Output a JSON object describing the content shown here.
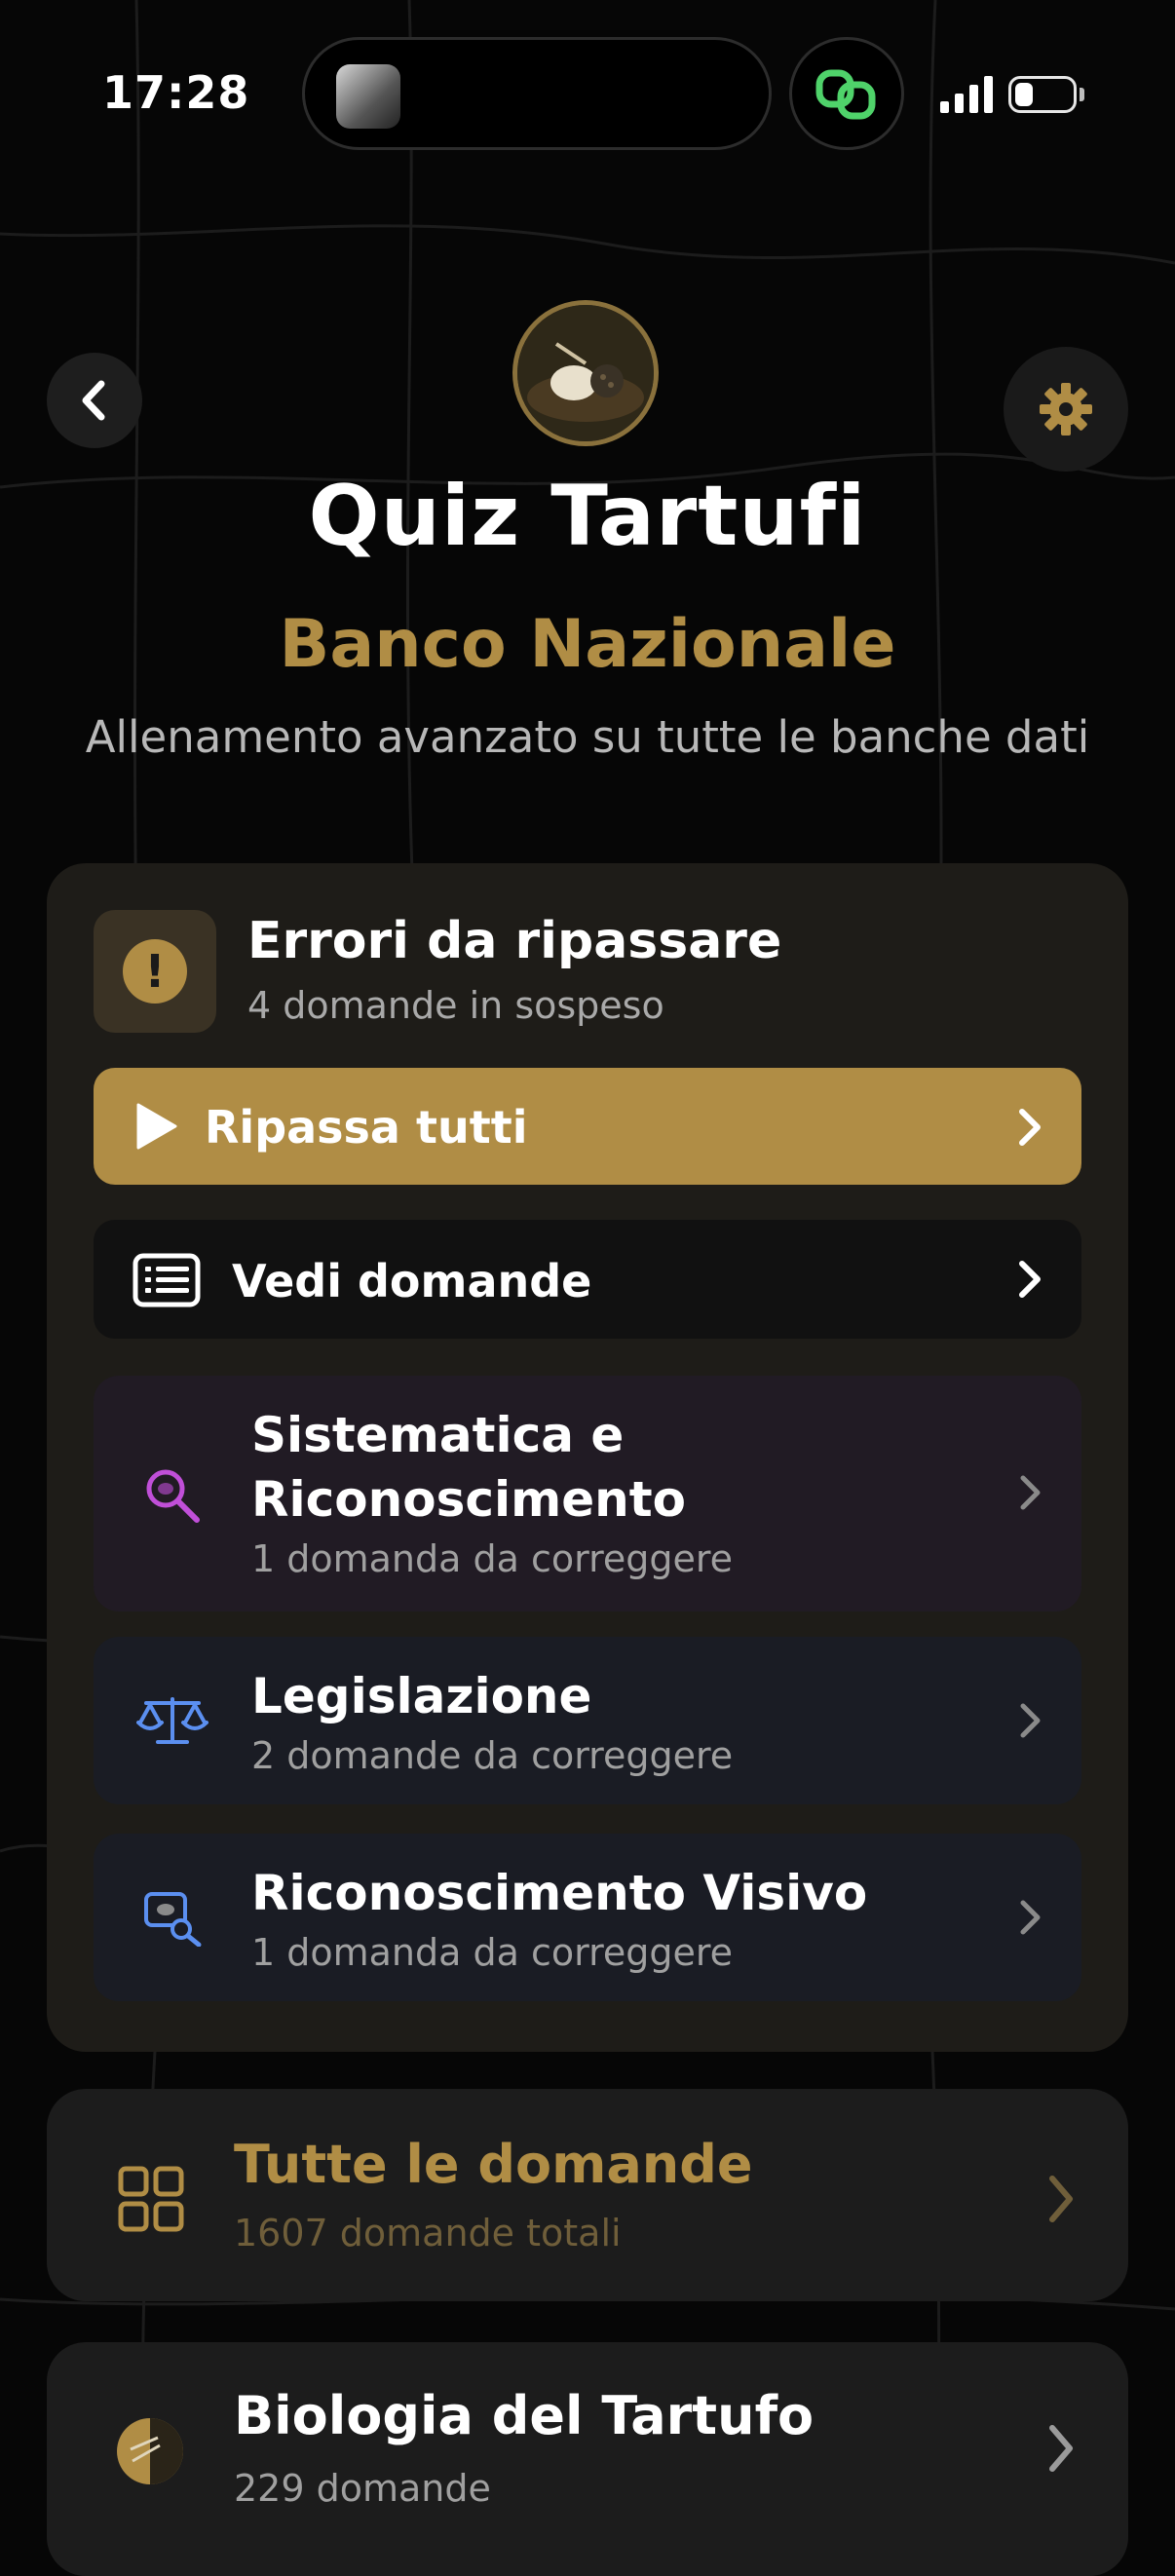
{
  "status_bar": {
    "time": "17:28"
  },
  "header": {
    "title": "Quiz Tartufi",
    "subtitle": "Banco Nazionale",
    "description": "Allenamento avanzato su tutte le banche dati"
  },
  "errors_panel": {
    "title": "Errori da ripassare",
    "subtitle": "4 domande in sospeso",
    "review_all_label": "Ripassa tutti",
    "view_questions_label": "Vedi domande",
    "categories": [
      {
        "title_line1": "Sistematica e",
        "title_line2": "Riconoscimento",
        "subtitle": "1 domanda da correggere",
        "icon": "magnifier-icon",
        "accent": "#c04fd8"
      },
      {
        "title_line1": "Legislazione",
        "subtitle": "2 domande da correggere",
        "icon": "scales-icon",
        "accent": "#5b8ff0"
      },
      {
        "title_line1": "Riconoscimento Visivo",
        "subtitle": "1 domanda da correggere",
        "icon": "image-search-icon",
        "accent": "#5b8ff0"
      }
    ]
  },
  "all_questions": {
    "title": "Tutte le domande",
    "subtitle": "1607 domande totali"
  },
  "section": {
    "title": "Biologia del Tartufo",
    "subtitle": "229 domande"
  },
  "colors": {
    "accent_gold": "#b08d45",
    "background": "#060606"
  }
}
